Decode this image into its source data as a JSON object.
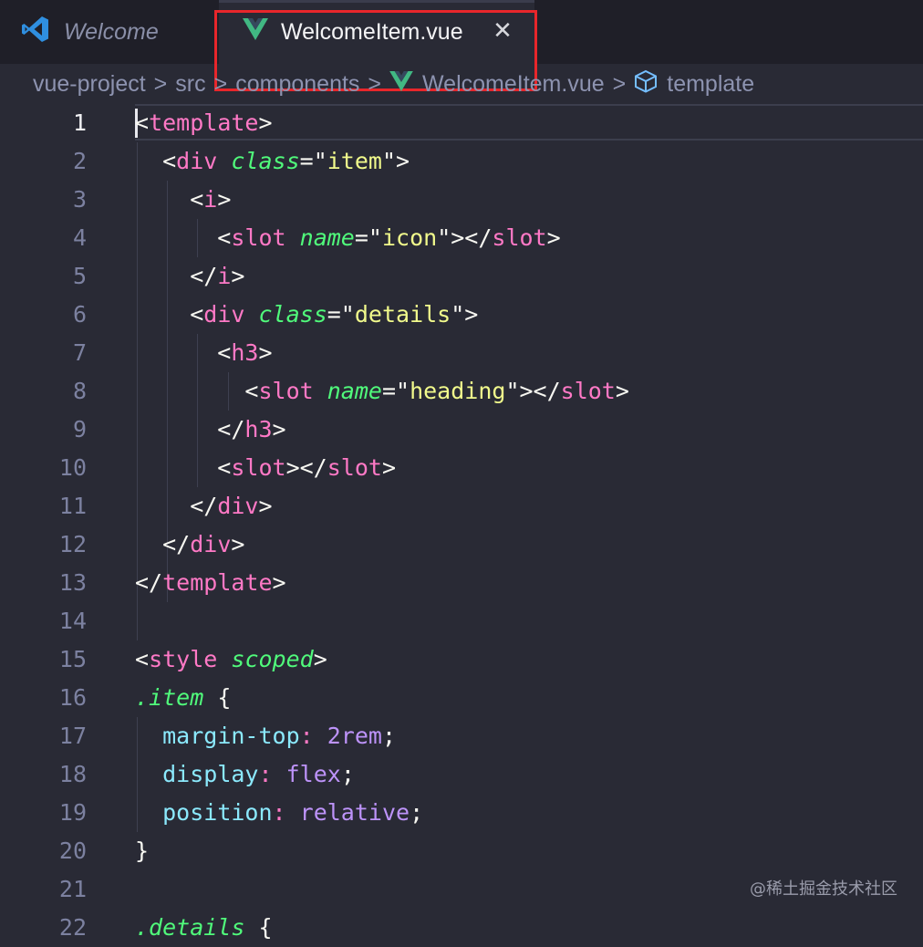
{
  "tabs": [
    {
      "label": "Welcome",
      "icon": "vscode-icon"
    },
    {
      "label": "WelcomeItem.vue",
      "icon": "vue-icon",
      "close_glyph": "✕"
    }
  ],
  "breadcrumb": [
    {
      "label": "vue-project"
    },
    {
      "label": "src"
    },
    {
      "label": "components"
    },
    {
      "label": "WelcomeItem.vue",
      "icon": "vue-icon"
    },
    {
      "label": "template",
      "icon": "cube-icon"
    }
  ],
  "breadcrumb_separator": ">",
  "active_line": 1,
  "lines": [
    {
      "n": "1",
      "tokens": [
        [
          "p",
          "<"
        ],
        [
          "t",
          "template"
        ],
        [
          "p",
          ">"
        ]
      ]
    },
    {
      "n": "2",
      "tokens": [
        [
          "p",
          "  <"
        ],
        [
          "t",
          "div"
        ],
        [
          "p",
          " "
        ],
        [
          "a",
          "class"
        ],
        [
          "p",
          "=\""
        ],
        [
          "s",
          "item"
        ],
        [
          "p",
          "\">"
        ]
      ]
    },
    {
      "n": "3",
      "tokens": [
        [
          "p",
          "    <"
        ],
        [
          "t",
          "i"
        ],
        [
          "p",
          ">"
        ]
      ]
    },
    {
      "n": "4",
      "tokens": [
        [
          "p",
          "      <"
        ],
        [
          "t",
          "slot"
        ],
        [
          "p",
          " "
        ],
        [
          "a",
          "name"
        ],
        [
          "p",
          "=\""
        ],
        [
          "s",
          "icon"
        ],
        [
          "p",
          "\"></"
        ],
        [
          "t",
          "slot"
        ],
        [
          "p",
          ">"
        ]
      ]
    },
    {
      "n": "5",
      "tokens": [
        [
          "p",
          "    </"
        ],
        [
          "t",
          "i"
        ],
        [
          "p",
          ">"
        ]
      ]
    },
    {
      "n": "6",
      "tokens": [
        [
          "p",
          "    <"
        ],
        [
          "t",
          "div"
        ],
        [
          "p",
          " "
        ],
        [
          "a",
          "class"
        ],
        [
          "p",
          "=\""
        ],
        [
          "s",
          "details"
        ],
        [
          "p",
          "\">"
        ]
      ]
    },
    {
      "n": "7",
      "tokens": [
        [
          "p",
          "      <"
        ],
        [
          "t",
          "h3"
        ],
        [
          "p",
          ">"
        ]
      ]
    },
    {
      "n": "8",
      "tokens": [
        [
          "p",
          "        <"
        ],
        [
          "t",
          "slot"
        ],
        [
          "p",
          " "
        ],
        [
          "a",
          "name"
        ],
        [
          "p",
          "=\""
        ],
        [
          "s",
          "heading"
        ],
        [
          "p",
          "\"></"
        ],
        [
          "t",
          "slot"
        ],
        [
          "p",
          ">"
        ]
      ]
    },
    {
      "n": "9",
      "tokens": [
        [
          "p",
          "      </"
        ],
        [
          "t",
          "h3"
        ],
        [
          "p",
          ">"
        ]
      ]
    },
    {
      "n": "10",
      "tokens": [
        [
          "p",
          "      <"
        ],
        [
          "t",
          "slot"
        ],
        [
          "p",
          "></"
        ],
        [
          "t",
          "slot"
        ],
        [
          "p",
          ">"
        ]
      ]
    },
    {
      "n": "11",
      "tokens": [
        [
          "p",
          "    </"
        ],
        [
          "t",
          "div"
        ],
        [
          "p",
          ">"
        ]
      ]
    },
    {
      "n": "12",
      "tokens": [
        [
          "p",
          "  </"
        ],
        [
          "t",
          "div"
        ],
        [
          "p",
          ">"
        ]
      ]
    },
    {
      "n": "13",
      "tokens": [
        [
          "p",
          "</"
        ],
        [
          "t",
          "template"
        ],
        [
          "p",
          ">"
        ]
      ]
    },
    {
      "n": "14",
      "tokens": []
    },
    {
      "n": "15",
      "tokens": [
        [
          "p",
          "<"
        ],
        [
          "t",
          "style"
        ],
        [
          "p",
          " "
        ],
        [
          "a",
          "scoped"
        ],
        [
          "p",
          ">"
        ]
      ]
    },
    {
      "n": "16",
      "tokens": [
        [
          "sel",
          ".item"
        ],
        [
          "p",
          " {"
        ]
      ]
    },
    {
      "n": "17",
      "tokens": [
        [
          "p",
          "  "
        ],
        [
          "prop",
          "margin-top"
        ],
        [
          "t",
          ":"
        ],
        [
          "p",
          " "
        ],
        [
          "val",
          "2rem"
        ],
        [
          "p",
          ";"
        ]
      ]
    },
    {
      "n": "18",
      "tokens": [
        [
          "p",
          "  "
        ],
        [
          "prop",
          "display"
        ],
        [
          "t",
          ":"
        ],
        [
          "p",
          " "
        ],
        [
          "val",
          "flex"
        ],
        [
          "p",
          ";"
        ]
      ]
    },
    {
      "n": "19",
      "tokens": [
        [
          "p",
          "  "
        ],
        [
          "prop",
          "position"
        ],
        [
          "t",
          ":"
        ],
        [
          "p",
          " "
        ],
        [
          "val",
          "relative"
        ],
        [
          "p",
          ";"
        ]
      ]
    },
    {
      "n": "20",
      "tokens": [
        [
          "p",
          "}"
        ]
      ]
    },
    {
      "n": "21",
      "tokens": []
    },
    {
      "n": "22",
      "tokens": [
        [
          "sel",
          ".details"
        ],
        [
          "p",
          " {"
        ]
      ]
    }
  ],
  "watermark": "@稀土掘金技术社区",
  "colors": {
    "background": "#292a35",
    "tab_bar": "#1f1f28",
    "tag": "#ff79c6",
    "attribute": "#50fa7b",
    "string": "#f1fa8c",
    "property": "#8be9fd",
    "value": "#bd93f9",
    "highlight_box": "#e8262b"
  }
}
